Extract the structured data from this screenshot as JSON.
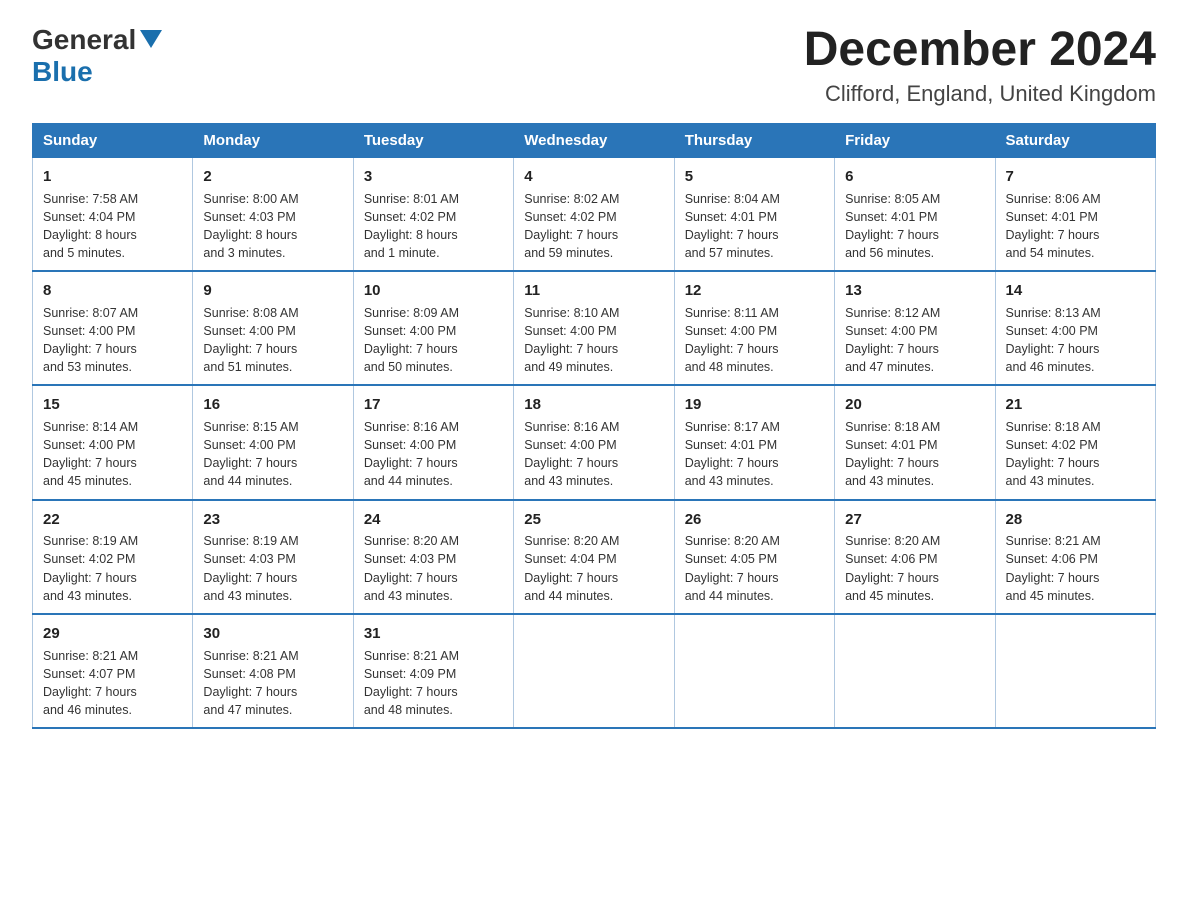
{
  "header": {
    "logo_general": "General",
    "logo_blue": "Blue",
    "month_title": "December 2024",
    "location": "Clifford, England, United Kingdom"
  },
  "weekdays": [
    "Sunday",
    "Monday",
    "Tuesday",
    "Wednesday",
    "Thursday",
    "Friday",
    "Saturday"
  ],
  "weeks": [
    [
      {
        "day": "1",
        "sunrise": "7:58 AM",
        "sunset": "4:04 PM",
        "daylight": "8 hours and 5 minutes."
      },
      {
        "day": "2",
        "sunrise": "8:00 AM",
        "sunset": "4:03 PM",
        "daylight": "8 hours and 3 minutes."
      },
      {
        "day": "3",
        "sunrise": "8:01 AM",
        "sunset": "4:02 PM",
        "daylight": "8 hours and 1 minute."
      },
      {
        "day": "4",
        "sunrise": "8:02 AM",
        "sunset": "4:02 PM",
        "daylight": "7 hours and 59 minutes."
      },
      {
        "day": "5",
        "sunrise": "8:04 AM",
        "sunset": "4:01 PM",
        "daylight": "7 hours and 57 minutes."
      },
      {
        "day": "6",
        "sunrise": "8:05 AM",
        "sunset": "4:01 PM",
        "daylight": "7 hours and 56 minutes."
      },
      {
        "day": "7",
        "sunrise": "8:06 AM",
        "sunset": "4:01 PM",
        "daylight": "7 hours and 54 minutes."
      }
    ],
    [
      {
        "day": "8",
        "sunrise": "8:07 AM",
        "sunset": "4:00 PM",
        "daylight": "7 hours and 53 minutes."
      },
      {
        "day": "9",
        "sunrise": "8:08 AM",
        "sunset": "4:00 PM",
        "daylight": "7 hours and 51 minutes."
      },
      {
        "day": "10",
        "sunrise": "8:09 AM",
        "sunset": "4:00 PM",
        "daylight": "7 hours and 50 minutes."
      },
      {
        "day": "11",
        "sunrise": "8:10 AM",
        "sunset": "4:00 PM",
        "daylight": "7 hours and 49 minutes."
      },
      {
        "day": "12",
        "sunrise": "8:11 AM",
        "sunset": "4:00 PM",
        "daylight": "7 hours and 48 minutes."
      },
      {
        "day": "13",
        "sunrise": "8:12 AM",
        "sunset": "4:00 PM",
        "daylight": "7 hours and 47 minutes."
      },
      {
        "day": "14",
        "sunrise": "8:13 AM",
        "sunset": "4:00 PM",
        "daylight": "7 hours and 46 minutes."
      }
    ],
    [
      {
        "day": "15",
        "sunrise": "8:14 AM",
        "sunset": "4:00 PM",
        "daylight": "7 hours and 45 minutes."
      },
      {
        "day": "16",
        "sunrise": "8:15 AM",
        "sunset": "4:00 PM",
        "daylight": "7 hours and 44 minutes."
      },
      {
        "day": "17",
        "sunrise": "8:16 AM",
        "sunset": "4:00 PM",
        "daylight": "7 hours and 44 minutes."
      },
      {
        "day": "18",
        "sunrise": "8:16 AM",
        "sunset": "4:00 PM",
        "daylight": "7 hours and 43 minutes."
      },
      {
        "day": "19",
        "sunrise": "8:17 AM",
        "sunset": "4:01 PM",
        "daylight": "7 hours and 43 minutes."
      },
      {
        "day": "20",
        "sunrise": "8:18 AM",
        "sunset": "4:01 PM",
        "daylight": "7 hours and 43 minutes."
      },
      {
        "day": "21",
        "sunrise": "8:18 AM",
        "sunset": "4:02 PM",
        "daylight": "7 hours and 43 minutes."
      }
    ],
    [
      {
        "day": "22",
        "sunrise": "8:19 AM",
        "sunset": "4:02 PM",
        "daylight": "7 hours and 43 minutes."
      },
      {
        "day": "23",
        "sunrise": "8:19 AM",
        "sunset": "4:03 PM",
        "daylight": "7 hours and 43 minutes."
      },
      {
        "day": "24",
        "sunrise": "8:20 AM",
        "sunset": "4:03 PM",
        "daylight": "7 hours and 43 minutes."
      },
      {
        "day": "25",
        "sunrise": "8:20 AM",
        "sunset": "4:04 PM",
        "daylight": "7 hours and 44 minutes."
      },
      {
        "day": "26",
        "sunrise": "8:20 AM",
        "sunset": "4:05 PM",
        "daylight": "7 hours and 44 minutes."
      },
      {
        "day": "27",
        "sunrise": "8:20 AM",
        "sunset": "4:06 PM",
        "daylight": "7 hours and 45 minutes."
      },
      {
        "day": "28",
        "sunrise": "8:21 AM",
        "sunset": "4:06 PM",
        "daylight": "7 hours and 45 minutes."
      }
    ],
    [
      {
        "day": "29",
        "sunrise": "8:21 AM",
        "sunset": "4:07 PM",
        "daylight": "7 hours and 46 minutes."
      },
      {
        "day": "30",
        "sunrise": "8:21 AM",
        "sunset": "4:08 PM",
        "daylight": "7 hours and 47 minutes."
      },
      {
        "day": "31",
        "sunrise": "8:21 AM",
        "sunset": "4:09 PM",
        "daylight": "7 hours and 48 minutes."
      },
      null,
      null,
      null,
      null
    ]
  ],
  "labels": {
    "sunrise": "Sunrise:",
    "sunset": "Sunset:",
    "daylight": "Daylight:"
  }
}
